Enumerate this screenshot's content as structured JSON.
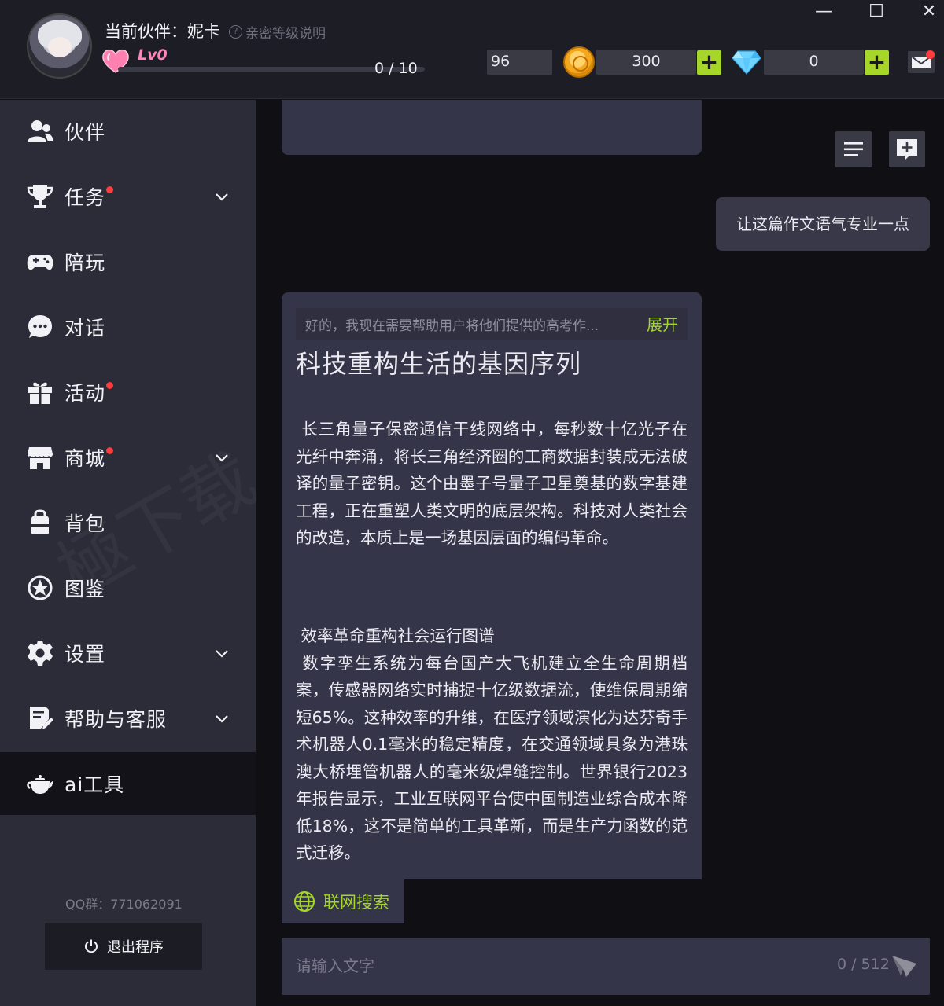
{
  "header": {
    "partner_label": "当前伙伴：妮卡",
    "intimacy_help": "亲密等级说明",
    "level": "Lv0",
    "level_progress": "0 / 10",
    "level_fraction": 0,
    "stat_value": "96",
    "coins": "300",
    "gems": "0",
    "plus_symbol": "+"
  },
  "window": {
    "minimize": "—",
    "maximize": "☐",
    "close": "✕"
  },
  "sidebar": {
    "items": [
      {
        "label": "伙伴",
        "icon": "user-group-icon",
        "has_dot": false,
        "has_chevron": false
      },
      {
        "label": "任务",
        "icon": "trophy-icon",
        "has_dot": true,
        "has_chevron": true
      },
      {
        "label": "陪玩",
        "icon": "gamepad-icon",
        "has_dot": false,
        "has_chevron": false
      },
      {
        "label": "对话",
        "icon": "chat-bubble-icon",
        "has_dot": false,
        "has_chevron": false
      },
      {
        "label": "活动",
        "icon": "gift-icon",
        "has_dot": true,
        "has_chevron": false
      },
      {
        "label": "商城",
        "icon": "store-icon",
        "has_dot": true,
        "has_chevron": true
      },
      {
        "label": "背包",
        "icon": "backpack-icon",
        "has_dot": false,
        "has_chevron": false
      },
      {
        "label": "图鉴",
        "icon": "star-badge-icon",
        "has_dot": false,
        "has_chevron": false
      },
      {
        "label": "设置",
        "icon": "gear-icon",
        "has_dot": false,
        "has_chevron": true
      },
      {
        "label": "帮助与客服",
        "icon": "help-form-icon",
        "has_dot": false,
        "has_chevron": true
      },
      {
        "label": "ai工具",
        "icon": "teapot-icon",
        "has_dot": false,
        "has_chevron": false,
        "active": true
      }
    ],
    "qq_group": "QQ群：771062091",
    "exit_label": "退出程序"
  },
  "chat": {
    "user_message": "让这篇作文语气专业一点",
    "thinking_summary": "好的，我现在需要帮助用户将他们提供的高考作...",
    "expand_label": "展开",
    "article_title": "科技重构生活的基因序列",
    "paragraph1": "长三角量子保密通信干线网络中，每秒数十亿光子在光纤中奔涌，将长三角经济圈的工商数据封装成无法破译的量子密钥。这个由墨子号量子卫星奠基的数字基建工程，正在重塑人类文明的底层架构。科技对人类社会的改造，本质上是一场基因层面的编码革命。",
    "paragraph2_heading": "效率革命重构社会运行图谱",
    "paragraph2": "数字孪生系统为每台国产大飞机建立全生命周期档案，传感器网络实时捕捉十亿级数据流，使维保周期缩短65%。这种效率的升维，在医疗领域演化为达芬奇手术机器人0.1毫米的稳定精度，在交通领域具象为港珠澳大桥埋管机器人的毫米级焊缝控制。世界银行2023年报告显示，工业互联网平台使中国制造业综合成本降低18%，这不是简单的工具革新，而是生产力函数的范式迁移。",
    "web_search_label": "联网搜索",
    "input_placeholder": "请输入文字",
    "input_value": "",
    "char_count": "0 / 512"
  },
  "colors": {
    "accent_green": "#a6d62a",
    "badge_red": "#ff3b3b",
    "level_pink": "#ff86b8",
    "sidebar_bg": "#2c2c39",
    "card_bg": "#35354a"
  }
}
